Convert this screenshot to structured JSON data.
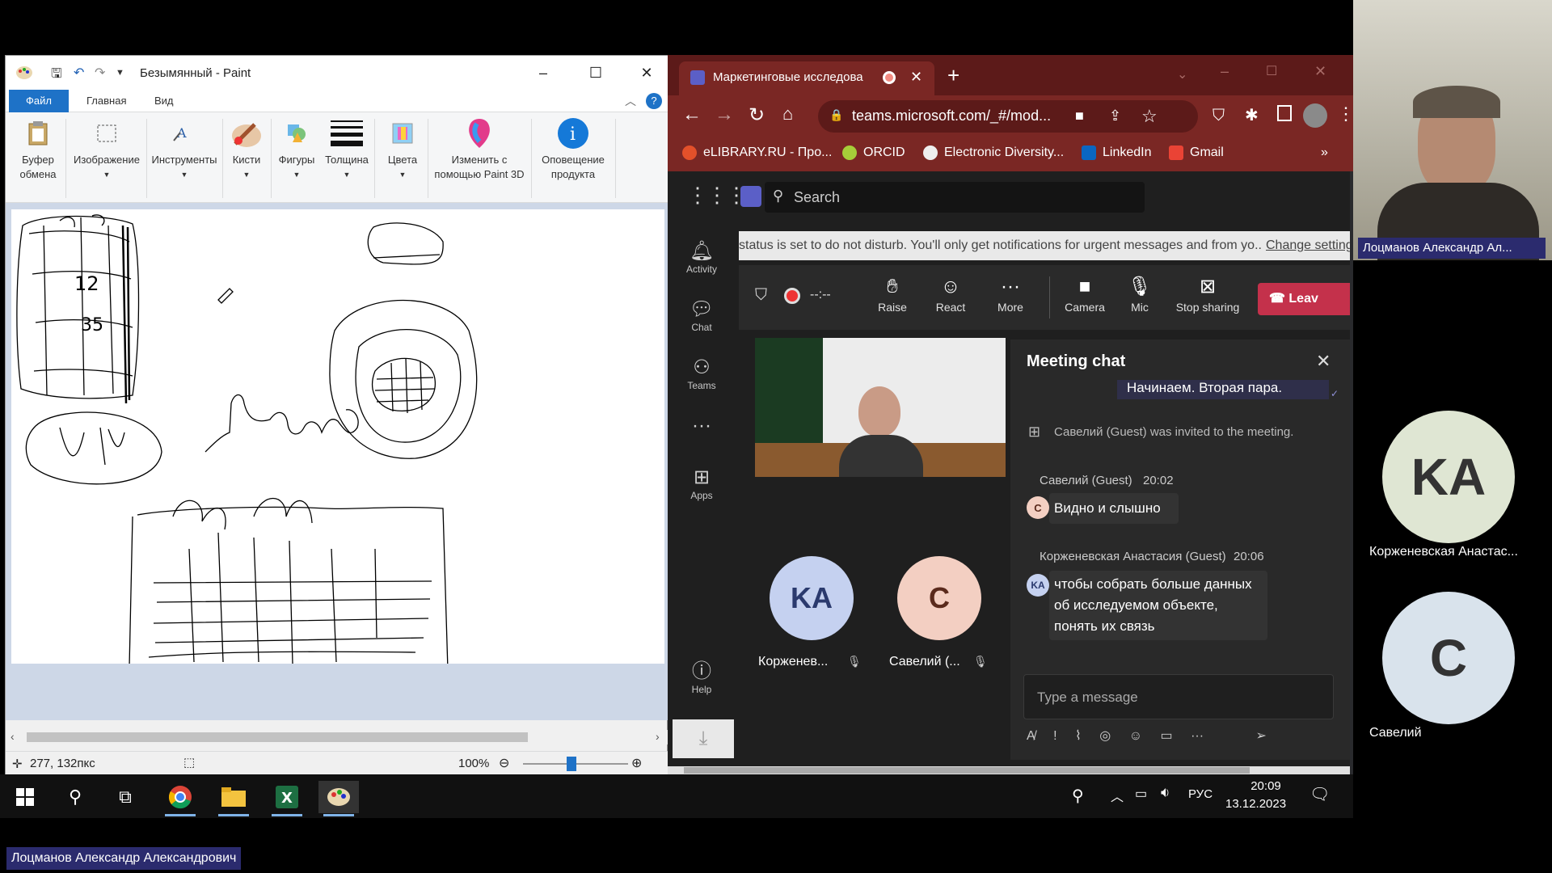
{
  "paint": {
    "title": "Безымянный - Paint",
    "tabs": {
      "file": "Файл",
      "home": "Главная",
      "view": "Вид"
    },
    "ribbon": {
      "clipboard": "Буфер обмена",
      "image": "Изображение",
      "tools": "Инструменты",
      "brushes": "Кисти",
      "shapes": "Фигуры",
      "size": "Толщина",
      "colors": "Цвета",
      "paint3d": "Изменить с помощью Paint 3D",
      "product_alert": "Оповещение продукта"
    },
    "status": {
      "coords": "277, 132пкс",
      "zoom": "100%"
    }
  },
  "browser": {
    "tab_title": "Маркетинговые исследова",
    "url": "teams.microsoft.com/_#/mod...",
    "bookmarks": [
      "eLIBRARY.RU - Про...",
      "ORCID",
      "Electronic Diversity...",
      "LinkedIn",
      "Gmail"
    ],
    "bookmarks_more": "»"
  },
  "teams": {
    "search_placeholder": "Search",
    "rail": {
      "activity": "Activity",
      "chat": "Chat",
      "teams": "Teams",
      "more": "···",
      "apps": "Apps",
      "help": "Help"
    },
    "banner_text": "status is set to do not disturb. You'll only get notifications for urgent messages and from yo...",
    "banner_link": "Change setting",
    "call": {
      "timer": "--:--",
      "raise": "Raise",
      "react": "React",
      "more": "More",
      "camera": "Camera",
      "mic": "Mic",
      "stop_sharing": "Stop sharing",
      "leave": "Leav"
    },
    "participants": [
      {
        "initials": "KA",
        "name": "Корженев...",
        "color": "#c5d1f0",
        "text_color": "#2b3a6e"
      },
      {
        "initials": "С",
        "name": "Савелий (...",
        "color": "#f3cfc2",
        "text_color": "#5a2a1c"
      }
    ],
    "chat": {
      "title": "Meeting chat",
      "my_message": "Начинаем. Вторая пара.",
      "system": "Савелий (Guest) was invited to the meeting.",
      "messages": [
        {
          "author": "Савелий (Guest)",
          "time": "20:02",
          "avatar": "С",
          "text": "Видно и слышно"
        },
        {
          "author": "Корженевская Анастасия (Guest)",
          "time": "20:06",
          "avatar": "KA",
          "text": "чтобы собрать больше данных об исследуемом объекте, понять их связь"
        }
      ],
      "input_placeholder": "Type a message"
    }
  },
  "right_panel": {
    "presenter_name": "Лоцманов Александр Ал...",
    "tiles": [
      {
        "initials": "KA",
        "name": "Корженевская Анастас...",
        "color": "#dfe6d3",
        "text_color": "#333"
      },
      {
        "initials": "C",
        "name": "Савелий",
        "color": "#d9e3ec",
        "text_color": "#333"
      }
    ]
  },
  "taskbar": {
    "lang": "РУС",
    "time": "20:09",
    "date": "13.12.2023"
  },
  "bottom_nametag": "Лоцманов Александр Александрович"
}
